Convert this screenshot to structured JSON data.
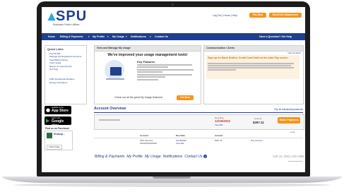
{
  "brand": {
    "logo_text": "SPU",
    "tagline": "Shakopee Public Utilities"
  },
  "header": {
    "links": [
      "Log Out",
      "Home",
      "Help"
    ],
    "pay_button": "Pay Now",
    "enroll_button": "Enroll for eStatements"
  },
  "nav": {
    "items": [
      "Home",
      "Billing & Payments",
      "My Profile",
      "My Usage",
      "Notifications",
      "Contact Us"
    ],
    "question": "Have a Question? Get Help"
  },
  "sidebar": {
    "title": "Quick Links",
    "items": [
      "Pay My Bill",
      "Manage My Registered Accounts",
      "View Billing History",
      "View Usage",
      "Report an Issue/Inquiry",
      "Get Help"
    ],
    "extra": [
      "2022 Residential Rebates",
      "Energy Assistance"
    ]
  },
  "badges": {
    "appstore_small": "Available on the",
    "appstore_big": "App Store",
    "googleplay_small": "GET IT ON",
    "googleplay_big": "Google play",
    "facebook_title": "Find us on Facebook",
    "facebook_page": "Shakop...",
    "facebook_follow": "Follow Page"
  },
  "usage_panel": {
    "title": "View and Manage My Usage",
    "headline": "We've improved your usage management tools!",
    "features_title": "Key Features",
    "cta_text": "Check out all the great My Usage features!",
    "button": "Get Now"
  },
  "alerts_panel": {
    "title": "Communication / Alerts",
    "view_all": "View All Alerts",
    "headline": "Sign up for Bank Draft or Credit Card Draft on the Auto Pay screen"
  },
  "account_overview": {
    "title": "Account Overview",
    "link": "Pay all outstanding balances",
    "summary": {
      "next_due_label": "Next Due",
      "next_due_date": "12/19/2022",
      "view_bill": "View Bill",
      "amount_label": "Amount",
      "amount_value": "$297.11",
      "total_due_label": "Total Due",
      "total_due_value": "$297.11",
      "make_payment": "Make Payment"
    },
    "expand": "Less",
    "table": {
      "headers": [
        "Account",
        "Due Date",
        "Amount"
      ],
      "row": {
        "service": "SPU Services",
        "due_date": "12/19/2022",
        "view_bill": "View Bill",
        "amount": "$297.11",
        "pay_link": "Pay Account"
      }
    }
  },
  "footer": {
    "links": [
      "Billing & Payments",
      "My Profile",
      "My Usage",
      "Notifications",
      "Contact Us"
    ],
    "call_us": "Call Us: (952) 445-1988"
  },
  "colors": {
    "primary": "#1f3f8f",
    "accent": "#f7941d",
    "logo_drop": "#27a9e1",
    "alert_bg": "#fdf1e0"
  }
}
